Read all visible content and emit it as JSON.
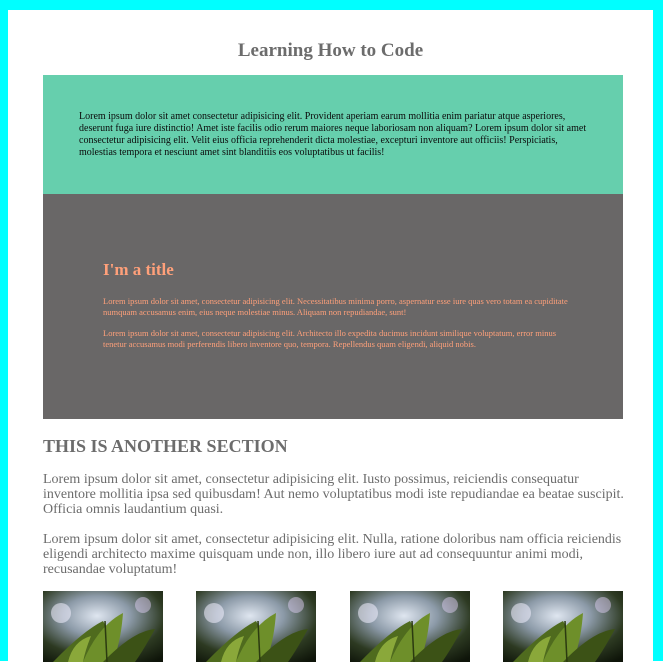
{
  "page": {
    "title": "Learning How to Code"
  },
  "teal_section": {
    "text": "Lorem ipsum dolor sit amet consectetur adipisicing elit. Provident aperiam earum mollitia enim pariatur atque asperiores, deserunt fuga iure distinctio! Amet iste facilis odio rerum maiores neque laboriosam non aliquam? Lorem ipsum dolor sit amet consectetur adipisicing elit. Velit eius officia reprehenderit dicta molestiae, excepturi inventore aut officiis! Perspiciatis, molestias tempora et nesciunt amet sint blanditiis eos voluptatibus ut facilis!"
  },
  "gray_section": {
    "title": "I'm a title",
    "paragraphs": [
      "Lorem ipsum dolor sit amet, consectetur adipisicing elit. Necessitatibus minima porro, aspernatur esse iure quas vero totam ea cupiditate numquam accusamus enim, eius neque molestiae minus. Aliquam non repudiandae, sunt!",
      "Lorem ipsum dolor sit amet, consectetur adipisicing elit. Architecto illo expedita ducimus incidunt similique voluptatum, error minus tenetur accusamus modi perferendis libero inventore quo, tempora. Repellendus quam eligendi, aliquid nobis."
    ]
  },
  "another_section": {
    "heading": "This is another section",
    "paragraphs": [
      "Lorem ipsum dolor sit amet, consectetur adipisicing elit. Iusto possimus, reiciendis consequatur inventore mollitia ipsa sed quibusdam! Aut nemo voluptatibus modi iste repudiandae ea beatae suscipit. Officia omnis laudantium quasi.",
      "Lorem ipsum dolor sit amet, consectetur adipisicing elit. Nulla, ratione doloribus nam officia reiciendis eligendi architecto maxime quisquam unde non, illo libero iure aut ad consequuntur animi modi, recusandae voluptatum!"
    ]
  },
  "gallery": {
    "images": [
      {
        "subject": "plant-photo"
      },
      {
        "subject": "plant-photo"
      },
      {
        "subject": "plant-photo"
      },
      {
        "subject": "plant-photo"
      }
    ]
  },
  "colors": {
    "frame_border": "#00ffff",
    "title_text": "#6c6c6c",
    "teal_background": "#66cfad",
    "gray_background": "#696767",
    "salmon_text": "#ffa07a"
  }
}
